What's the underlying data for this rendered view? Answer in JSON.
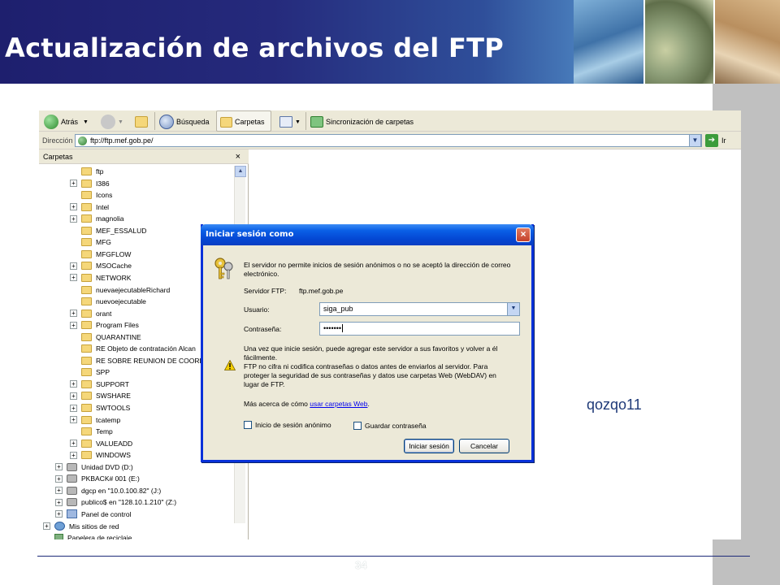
{
  "slide": {
    "title": "Actualización de archivos del FTP",
    "side_note": "qozqo11",
    "page_number": "34"
  },
  "toolbar": {
    "back_label": "Atrás",
    "search_label": "Búsqueda",
    "folders_label": "Carpetas",
    "sync_label": "Sincronización de carpetas"
  },
  "address": {
    "label": "Dirección",
    "value": "ftp://ftp.mef.gob.pe/",
    "go_label": "Ir"
  },
  "folders_pane": {
    "header": "Carpetas",
    "close": "×",
    "items": [
      {
        "label": "ftp",
        "expandable": false,
        "icon": "folder-icon"
      },
      {
        "label": "I386",
        "expandable": true,
        "icon": "folder-icon"
      },
      {
        "label": "Icons",
        "expandable": false,
        "icon": "folder-icon"
      },
      {
        "label": "Intel",
        "expandable": true,
        "icon": "folder-icon"
      },
      {
        "label": "magnolia",
        "expandable": true,
        "icon": "folder-icon"
      },
      {
        "label": "MEF_ESSALUD",
        "expandable": false,
        "icon": "folder-icon"
      },
      {
        "label": "MFG",
        "expandable": false,
        "icon": "folder-icon"
      },
      {
        "label": "MFGFLOW",
        "expandable": false,
        "icon": "folder-icon"
      },
      {
        "label": "MSOCache",
        "expandable": true,
        "icon": "folder-icon"
      },
      {
        "label": "NETWORK",
        "expandable": true,
        "icon": "folder-icon"
      },
      {
        "label": "nuevaejecutableRichard",
        "expandable": false,
        "icon": "folder-icon"
      },
      {
        "label": "nuevoejecutable",
        "expandable": false,
        "icon": "folder-icon"
      },
      {
        "label": "orant",
        "expandable": true,
        "icon": "folder-icon"
      },
      {
        "label": "Program Files",
        "expandable": true,
        "icon": "folder-icon"
      },
      {
        "label": "QUARANTINE",
        "expandable": false,
        "icon": "folder-icon"
      },
      {
        "label": "RE Objeto de contratación Alcan",
        "expandable": false,
        "icon": "folder-icon"
      },
      {
        "label": "RE SOBRE REUNION DE COORDI",
        "expandable": false,
        "icon": "folder-icon"
      },
      {
        "label": "SPP",
        "expandable": false,
        "icon": "folder-icon"
      },
      {
        "label": "SUPPORT",
        "expandable": true,
        "icon": "folder-icon"
      },
      {
        "label": "SWSHARE",
        "expandable": true,
        "icon": "folder-icon"
      },
      {
        "label": "SWTOOLS",
        "expandable": true,
        "icon": "folder-icon"
      },
      {
        "label": "tcatemp",
        "expandable": true,
        "icon": "folder-icon"
      },
      {
        "label": "Temp",
        "expandable": false,
        "icon": "folder-icon"
      },
      {
        "label": "VALUEADD",
        "expandable": true,
        "icon": "folder-icon"
      },
      {
        "label": "WINDOWS",
        "expandable": true,
        "icon": "folder-icon"
      }
    ],
    "root_items": [
      {
        "label": "Unidad DVD (D:)",
        "icon": "dvd-drive-icon"
      },
      {
        "label": "PKBACK# 001 (E:)",
        "icon": "drive-icon"
      },
      {
        "label": "dgcp en \"10.0.100.82\" (J:)",
        "icon": "network-drive-icon"
      },
      {
        "label": "publico$ en \"128.10.1.210\" (Z:)",
        "icon": "network-drive-icon"
      },
      {
        "label": "Panel de control",
        "icon": "control-panel-icon"
      }
    ],
    "top_items": [
      {
        "label": "Mis sitios de red",
        "icon": "network-places-icon"
      },
      {
        "label": "Papelera de reciclaje",
        "icon": "recycle-bin-icon"
      }
    ]
  },
  "dialog": {
    "title": "Iniciar sesión como",
    "close": "×",
    "message_line1": "El servidor no permite inicios de sesión anónimos o no se aceptó la  dirección de correo",
    "message_line2": "electrónico.",
    "server_label": "Servidor FTP:",
    "server_value": "ftp.mef.gob.pe",
    "user_label": "Usuario:",
    "user_value": "siga_pub",
    "password_label": "Contraseña:",
    "password_value": "•••••••",
    "info_line1": "Una vez que inicie sesión, puede agregar este servidor a sus favoritos y volver a él",
    "info_line2": "fácilmente.",
    "info_line3": "FTP no cifra ni codifica contraseñas o datos antes de enviarlos al servidor.  Para",
    "info_line4": "proteger la seguridad de sus contraseñas y datos use carpetas Web (WebDAV) en",
    "info_line5": "lugar de FTP.",
    "more_prefix": "Más acerca de cómo ",
    "more_link": "usar carpetas Web",
    "more_suffix": ".",
    "anon_checkbox": "Inicio de sesión anónimo",
    "save_checkbox": "Guardar contraseña",
    "login_button": "Iniciar sesión",
    "cancel_button": "Cancelar"
  }
}
